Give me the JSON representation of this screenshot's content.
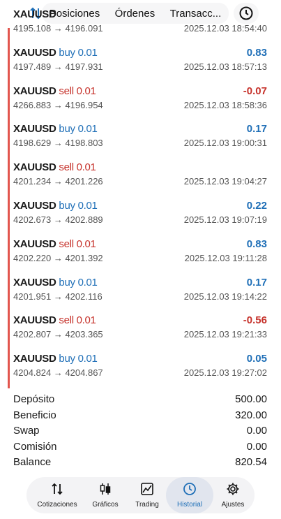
{
  "header": {
    "tabs": [
      "Posiciones",
      "Órdenes",
      "Transacc..."
    ],
    "sort_icon": "sort-arrows-icon",
    "clock_icon": "clock-icon"
  },
  "deals": [
    {
      "symbol": "XAUUSD",
      "side": "",
      "volume": "",
      "prices": "4195.108 → 4196.091",
      "time": "2025.12.03 18:54:40",
      "profit": "",
      "profit_sign": "pos"
    },
    {
      "symbol": "XAUUSD",
      "side": "buy",
      "volume": "0.01",
      "prices": "4197.489 → 4197.931",
      "time": "2025.12.03 18:57:13",
      "profit": "0.83",
      "profit_sign": "pos"
    },
    {
      "symbol": "XAUUSD",
      "side": "sell",
      "volume": "0.01",
      "prices": "4266.883 → 4196.954",
      "time": "2025.12.03 18:58:36",
      "profit": "-0.07",
      "profit_sign": "neg"
    },
    {
      "symbol": "XAUUSD",
      "side": "buy",
      "volume": "0.01",
      "prices": "4198.629 → 4198.803",
      "time": "2025.12.03 19:00:31",
      "profit": "0.17",
      "profit_sign": "pos"
    },
    {
      "symbol": "XAUUSD",
      "side": "sell",
      "volume": "0.01",
      "prices": "4201.234 → 4201.226",
      "time": "2025.12.03 19:04:27",
      "profit": "",
      "profit_sign": "pos"
    },
    {
      "symbol": "XAUUSD",
      "side": "buy",
      "volume": "0.01",
      "prices": "4202.673 → 4202.889",
      "time": "2025.12.03 19:07:19",
      "profit": "0.22",
      "profit_sign": "pos"
    },
    {
      "symbol": "XAUUSD",
      "side": "sell",
      "volume": "0.01",
      "prices": "4202.220 → 4201.392",
      "time": "2025.12.03 19:11:28",
      "profit": "0.83",
      "profit_sign": "pos"
    },
    {
      "symbol": "XAUUSD",
      "side": "buy",
      "volume": "0.01",
      "prices": "4201.951 → 4202.116",
      "time": "2025.12.03 19:14:22",
      "profit": "0.17",
      "profit_sign": "pos"
    },
    {
      "symbol": "XAUUSD",
      "side": "sell",
      "volume": "0.01",
      "prices": "4202.807 → 4203.365",
      "time": "2025.12.03 19:21:33",
      "profit": "-0.56",
      "profit_sign": "neg"
    },
    {
      "symbol": "XAUUSD",
      "side": "buy",
      "volume": "0.01",
      "prices": "4204.824 → 4204.867",
      "time": "2025.12.03 19:27:02",
      "profit": "0.05",
      "profit_sign": "pos"
    }
  ],
  "summary": [
    {
      "label": "Depósito",
      "value": "500.00"
    },
    {
      "label": "Beneficio",
      "value": "320.00"
    },
    {
      "label": "Swap",
      "value": "0.00"
    },
    {
      "label": "Comisión",
      "value": "0.00"
    },
    {
      "label": "Balance",
      "value": "820.54"
    }
  ],
  "nav": [
    {
      "label": "Cotizaciones",
      "icon": "quotes-arrows-icon",
      "active": false
    },
    {
      "label": "Gráficos",
      "icon": "candlestick-icon",
      "active": false
    },
    {
      "label": "Trading",
      "icon": "trading-chart-icon",
      "active": false
    },
    {
      "label": "Historial",
      "icon": "history-clock-icon",
      "active": true
    },
    {
      "label": "Ajustes",
      "icon": "gear-icon",
      "active": false
    }
  ],
  "colors": {
    "buy": "#1f6fb7",
    "sell": "#c6322b",
    "accent": "#e2564e"
  }
}
